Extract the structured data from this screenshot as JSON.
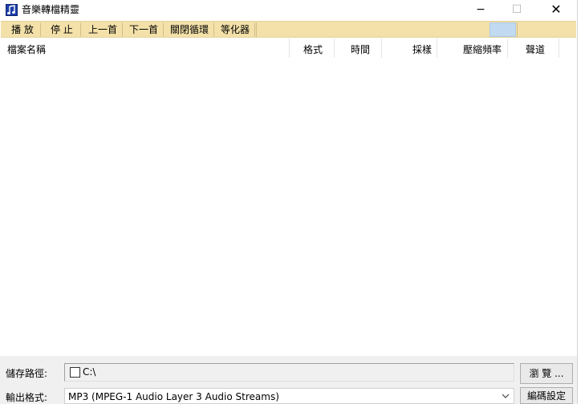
{
  "window": {
    "title": "音樂轉檔精靈",
    "controls": {
      "minimize": "−",
      "maximize": "☐",
      "close": "✕"
    }
  },
  "toolbar": {
    "play": "播 放",
    "stop": "停 止",
    "prev": "上一首",
    "next": "下一首",
    "loop": "關閉循環",
    "equalizer": "等化器",
    "swatch_color": "#c2daf1"
  },
  "list": {
    "columns": [
      "檔案名稱",
      "格式",
      "時間",
      "採樣",
      "壓縮頻率",
      "聲道"
    ],
    "rows": []
  },
  "bottom": {
    "path_label": "儲存路徑:",
    "path_value": "C:\\",
    "browse_label": "瀏 覽 ...",
    "format_label": "輸出格式:",
    "format_value": "MP3  (MPEG-1 Audio Layer 3 Audio Streams)",
    "encode_label": "編碼設定"
  },
  "colors": {
    "toolbar_bg": "#f3e1a9",
    "app_icon": "#1d3fa8"
  }
}
